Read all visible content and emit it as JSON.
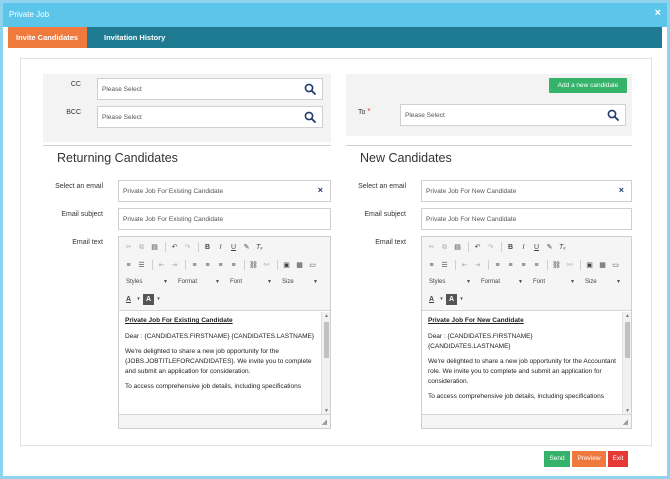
{
  "window": {
    "title": "Private Job",
    "close_glyph": "×"
  },
  "tabs": [
    {
      "label": "Invite Candidates",
      "active": true
    },
    {
      "label": "Invitation History",
      "active": false
    }
  ],
  "recipients": {
    "cc_label": "CC",
    "cc_value": "Please Select",
    "bcc_label": "BCC",
    "bcc_value": "Please Select",
    "to_label": "To",
    "to_required": "*",
    "to_value": "Please Select",
    "add_candidate_label": "Add a new candidate"
  },
  "returning": {
    "title": "Returning Candidates",
    "select_email_label": "Select an email",
    "select_email_value": "Private Job For Existing Candidate",
    "subject_label": "Email subject",
    "subject_value": "Private Job For Existing Candidate",
    "text_label": "Email text",
    "body": {
      "heading": "Private Job For Existing Candidate",
      "greeting": "Dear : {CANDIDATES.FIRSTNAME} {CANDIDATES.LASTNAME}",
      "para1": "We're delighted to share a new job opportunity for the {JOBS.JOBTITLEFORCANDIDATES}. We invite you to complete and submit an application for consideration.",
      "para2": "To access comprehensive job details, including specifications"
    }
  },
  "new_candidates": {
    "title": "New Candidates",
    "select_email_label": "Select an email",
    "select_email_value": "Private Job For New Candidate",
    "subject_label": "Email subject",
    "subject_value": "Private Job For New Candidate",
    "text_label": "Email text",
    "body": {
      "heading": "Private Job For New Candidate",
      "greeting": "Dear : {CANDIDATES.FIRSTNAME} {CANDIDATES.LASTNAME}",
      "para1": "We're delighted to share a new job opportunity for the Accountant role. We invite you to complete and submit an application for consideration.",
      "para2": "To access comprehensive job details, including specifications"
    }
  },
  "toolbar": {
    "styles": "Styles",
    "format": "Format",
    "font": "Font",
    "size": "Size",
    "bold": "B",
    "italic": "I",
    "underline": "U",
    "font_color": "A",
    "bg_color": "A"
  },
  "footer": {
    "send": "Send",
    "preview": "Preview",
    "exit": "Exit"
  },
  "colors": {
    "title_bar": "#5cc6ea",
    "tab_bar": "#1e7b92",
    "active_tab": "#f07a3d",
    "send": "#35b36b",
    "preview": "#f07a3d",
    "exit": "#e53935"
  }
}
